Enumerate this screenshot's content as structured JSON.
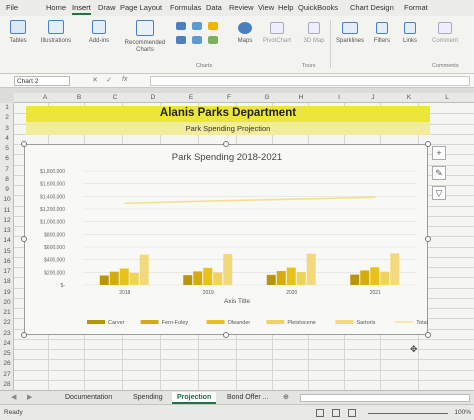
{
  "ribbon": {
    "tabs": [
      "File",
      "Home",
      "Insert",
      "Draw",
      "Page Layout",
      "Formulas",
      "Data",
      "Review",
      "View",
      "Help",
      "QuickBooks",
      "Chart Design",
      "Format"
    ],
    "active_tab": "Insert",
    "buttons": {
      "tables": "Tables",
      "illustrations": "Illustrations",
      "addins": "Add-ins",
      "recommended_charts": "Recommended Charts",
      "maps": "Maps",
      "pivotchart": "PivotChart",
      "map3d": "3D Map",
      "sparklines": "Sparklines",
      "filters": "Filters",
      "links": "Links",
      "comment": "Comment"
    },
    "groups": {
      "charts": "Charts",
      "tours": "Tours",
      "comments": "Comments"
    }
  },
  "formula_bar": {
    "name_box": "Chart 2",
    "fx": "fx"
  },
  "grid": {
    "columns": [
      "A",
      "B",
      "C",
      "D",
      "E",
      "F",
      "G",
      "H",
      "I",
      "J",
      "K",
      "L"
    ],
    "rows": [
      "1",
      "2",
      "3",
      "4",
      "5",
      "6",
      "7",
      "8",
      "9",
      "10",
      "11",
      "12",
      "13",
      "14",
      "15",
      "16",
      "17",
      "18",
      "19",
      "20",
      "21",
      "22",
      "23",
      "24",
      "25",
      "26",
      "27",
      "28"
    ]
  },
  "sheet": {
    "title": "Alanis Parks Department",
    "subtitle": "Park Spending Projection"
  },
  "chart_data": {
    "type": "bar",
    "title": "Park Spending 2018-2021",
    "xlabel": "Axis Title",
    "ylabel": "",
    "categories": [
      "2018",
      "2019",
      "2020",
      "2021"
    ],
    "ylim": [
      0,
      1800000
    ],
    "ytick_labels": [
      "$-",
      "$200,000",
      "$400,000",
      "$600,000",
      "$800,000",
      "$1,000,000",
      "$1,200,000",
      "$1,400,000",
      "$1,600,000",
      "$1,800,000"
    ],
    "yticks": [
      0,
      200000,
      400000,
      600000,
      800000,
      1000000,
      1200000,
      1400000,
      1600000,
      1800000
    ],
    "grid": true,
    "legend_position": "bottom",
    "series": [
      {
        "name": "Carver",
        "color": "#b8940f",
        "values": [
          150000,
          155000,
          160000,
          165000
        ]
      },
      {
        "name": "Fern-Foley",
        "color": "#d4ac12",
        "values": [
          210000,
          215000,
          220000,
          230000
        ]
      },
      {
        "name": "Oleander",
        "color": "#e8c21a",
        "values": [
          260000,
          270000,
          275000,
          280000
        ]
      },
      {
        "name": "Pleistocene",
        "color": "#f0d35a",
        "values": [
          190000,
          195000,
          205000,
          210000
        ]
      },
      {
        "name": "Sartoris",
        "color": "#f3d97c",
        "values": [
          480000,
          490000,
          495000,
          500000
        ]
      },
      {
        "name": "Total",
        "color": "#f5e08e",
        "type": "line",
        "values": [
          1290000,
          1325000,
          1355000,
          1385000
        ]
      }
    ]
  },
  "sheet_tabs": [
    "Documentation",
    "Spending",
    "Projection",
    "Bond Offer ..."
  ],
  "active_sheet": "Projection",
  "status": {
    "left": "Ready",
    "zoom": "100%"
  }
}
